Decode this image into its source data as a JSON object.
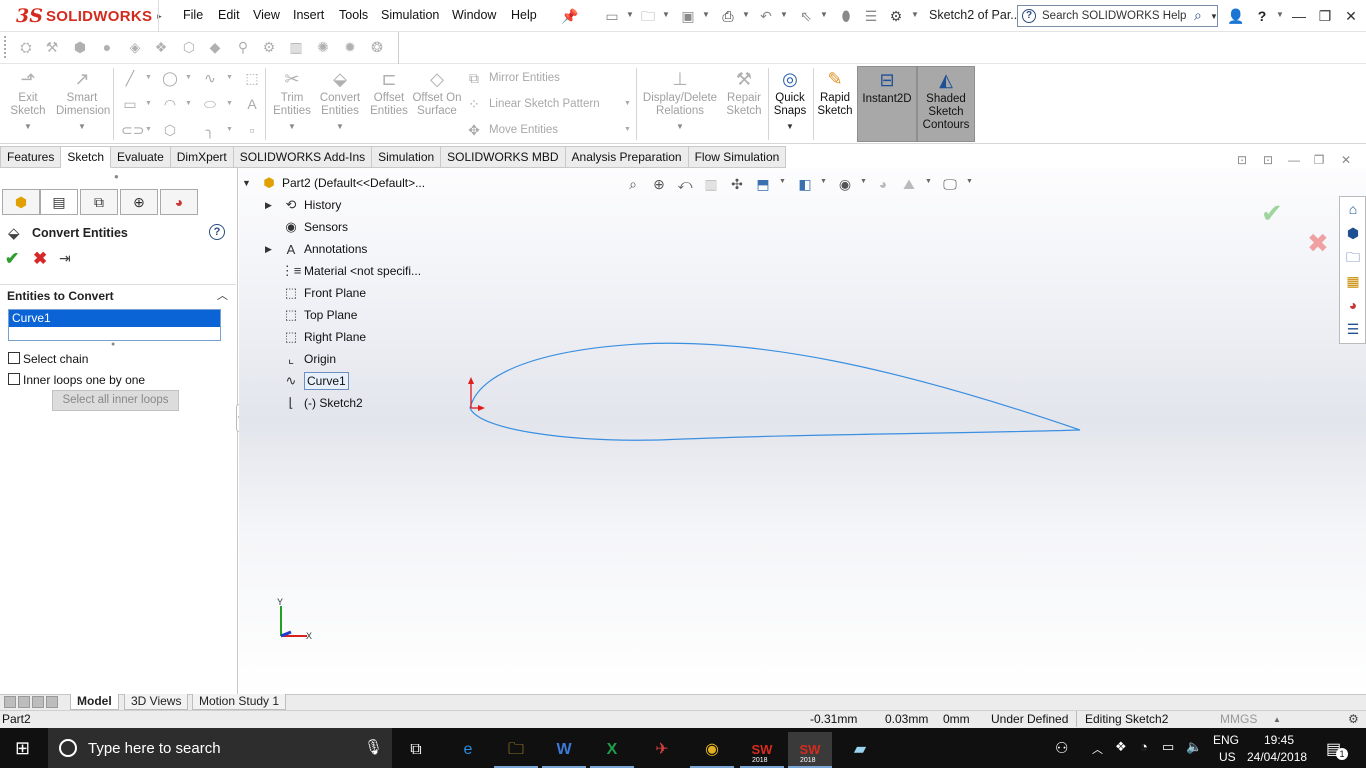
{
  "app": {
    "logo_ds": "3S",
    "logo_text": "SOLIDWORKS",
    "doc_title": "Sketch2 of Par...",
    "menu": [
      "File",
      "Edit",
      "View",
      "Insert",
      "Tools",
      "Simulation",
      "Window",
      "Help"
    ],
    "help_search_placeholder": "Search SOLIDWORKS Help"
  },
  "commandmanager": {
    "exit_sketch": "Exit Sketch",
    "smart_dimension": "Smart Dimension",
    "trim_entities": "Trim Entities",
    "convert_entities": "Convert Entities",
    "offset_entities": "Offset Entities",
    "offset_on_surface": "Offset On Surface",
    "mirror_entities": "Mirror Entities",
    "linear_sketch_pattern": "Linear Sketch Pattern",
    "move_entities": "Move Entities",
    "display_delete_relations": "Display/Delete Relations",
    "repair_sketch": "Repair Sketch",
    "quick_snaps": "Quick Snaps",
    "rapid_sketch": "Rapid Sketch",
    "instant2d": "Instant2D",
    "shaded_sketch_contours": "Shaded Sketch Contours"
  },
  "tabs": [
    "Features",
    "Sketch",
    "Evaluate",
    "DimXpert",
    "SOLIDWORKS Add-Ins",
    "Simulation",
    "SOLIDWORKS MBD",
    "Analysis Preparation",
    "Flow Simulation"
  ],
  "active_tab": "Sketch",
  "property_manager": {
    "title": "Convert Entities",
    "section_title": "Entities to Convert",
    "selected_entity": "Curve1",
    "select_chain_label": "Select chain",
    "inner_loops_label": "Inner loops one by one",
    "select_inner_button": "Select all inner loops"
  },
  "feature_tree": {
    "root": "Part2  (Default<<Default>...",
    "items": [
      {
        "label": "History",
        "icon": "history-icon",
        "expandable": true
      },
      {
        "label": "Sensors",
        "icon": "sensor-icon",
        "expandable": false
      },
      {
        "label": "Annotations",
        "icon": "annotation-icon",
        "expandable": true
      },
      {
        "label": "Material <not specifi...",
        "icon": "material-icon",
        "expandable": false
      },
      {
        "label": "Front Plane",
        "icon": "plane-icon",
        "expandable": false
      },
      {
        "label": "Top Plane",
        "icon": "plane-icon",
        "expandable": false
      },
      {
        "label": "Right Plane",
        "icon": "plane-icon",
        "expandable": false
      },
      {
        "label": "Origin",
        "icon": "origin-icon",
        "expandable": false
      },
      {
        "label": "Curve1",
        "icon": "curve-icon",
        "expandable": false,
        "selected": true
      },
      {
        "label": "(-) Sketch2",
        "icon": "sketch-icon",
        "expandable": false
      }
    ]
  },
  "triad": {
    "y_label": "Y",
    "x_label": "X"
  },
  "bottom_tabs": [
    "Model",
    "3D Views",
    "Motion Study 1"
  ],
  "status_bar": {
    "doc_name": "Part2",
    "x_coord": "-0.31mm",
    "y_coord": "0.03mm",
    "z_coord": "0mm",
    "definition": "Under Defined",
    "editing": "Editing Sketch2",
    "units": "MMGS"
  },
  "taskbar": {
    "search_placeholder": "Type here to search",
    "language": "ENG",
    "region": "US",
    "time": "19:45",
    "date": "24/04/2018",
    "notification_count": "1",
    "sw_badge": "2018"
  },
  "colors": {
    "brand_red": "#d52b1e",
    "selection_blue": "#0a64d6",
    "curve_blue": "#3a8fe0",
    "accept_green": "#2e9e2e",
    "cancel_red": "#d62828"
  }
}
